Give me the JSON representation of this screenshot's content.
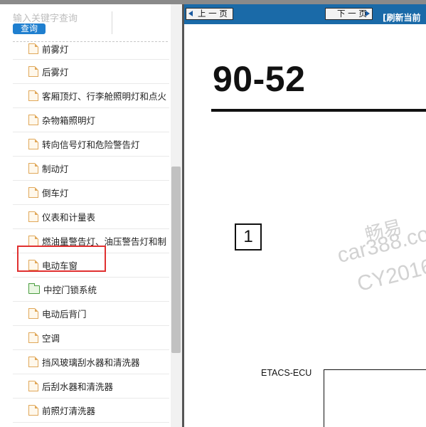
{
  "search": {
    "placeholder": "输入关键字查询",
    "button_label": "查询"
  },
  "tree": {
    "items": [
      {
        "label": "前雾灯",
        "icon": "document-icon"
      },
      {
        "label": "后雾灯",
        "icon": "document-icon"
      },
      {
        "label": "客厢顶灯、行李舱照明灯和点火",
        "icon": "document-icon"
      },
      {
        "label": "杂物箱照明灯",
        "icon": "document-icon"
      },
      {
        "label": "转向信号灯和危险警告灯",
        "icon": "document-icon"
      },
      {
        "label": "制动灯",
        "icon": "document-icon"
      },
      {
        "label": "倒车灯",
        "icon": "document-icon"
      },
      {
        "label": "仪表和计量表",
        "icon": "document-icon"
      },
      {
        "label": "燃油量警告灯、油压警告灯和制",
        "icon": "document-icon"
      },
      {
        "label": "电动车窗",
        "icon": "document-icon",
        "highlighted": true
      },
      {
        "label": "中控门锁系统",
        "icon": "folder-icon"
      },
      {
        "label": "电动后背门",
        "icon": "document-icon"
      },
      {
        "label": "空调",
        "icon": "document-icon"
      },
      {
        "label": "挡风玻璃刮水器和清洗器",
        "icon": "document-icon"
      },
      {
        "label": "后刮水器和清洗器",
        "icon": "document-icon"
      },
      {
        "label": "前照灯清洗器",
        "icon": "document-icon"
      }
    ]
  },
  "nav": {
    "prev_label": "上 一 页",
    "next_label": "下 一 页",
    "refresh_label": "[刷新当前"
  },
  "document": {
    "page_number": "90-52",
    "callout_number": "1",
    "watermark_line1": "畅易",
    "watermark_line2": "car388.co",
    "watermark_line3": "CY2016",
    "ecu_label": "ETACS-ECU"
  },
  "colors": {
    "nav_bar": "#1a6aa8",
    "search_button": "#1f7fcf",
    "highlight_border": "#e03030"
  }
}
